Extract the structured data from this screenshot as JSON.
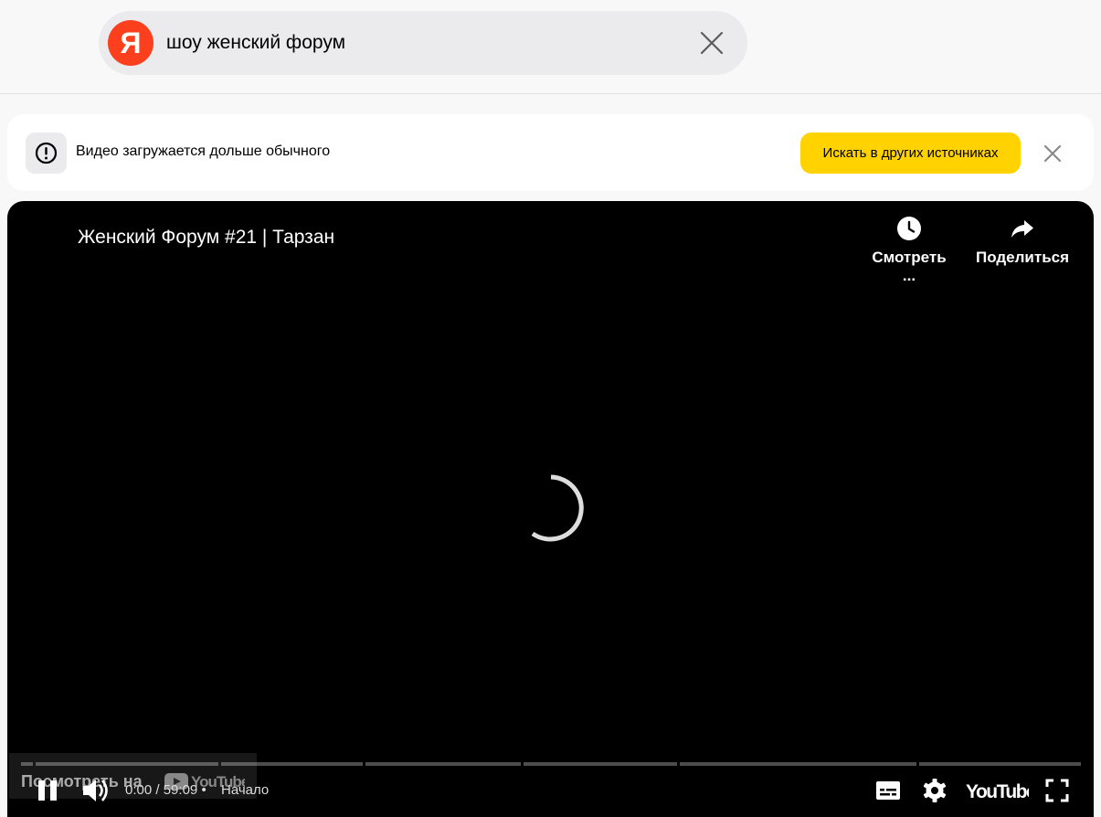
{
  "search": {
    "logo_letter": "Я",
    "query": "шоу женский форум"
  },
  "notice": {
    "text": "Видео загружается дольше обычного",
    "button_label": "Искать в других источниках"
  },
  "player": {
    "title": "Женский Форум #21 | Тарзан",
    "watch_later_label": "Смотреть ...",
    "share_label": "Поделиться",
    "watch_on_label": "Посмотреть на",
    "current_time": "0:00",
    "duration": "59:09",
    "time_separator": "/",
    "chapter_dot": "•",
    "chapter": "Начало",
    "youtube_label": "YouTube",
    "progress": 0
  },
  "colors": {
    "brand": "#fc3f1d",
    "accent": "#ffd200"
  }
}
